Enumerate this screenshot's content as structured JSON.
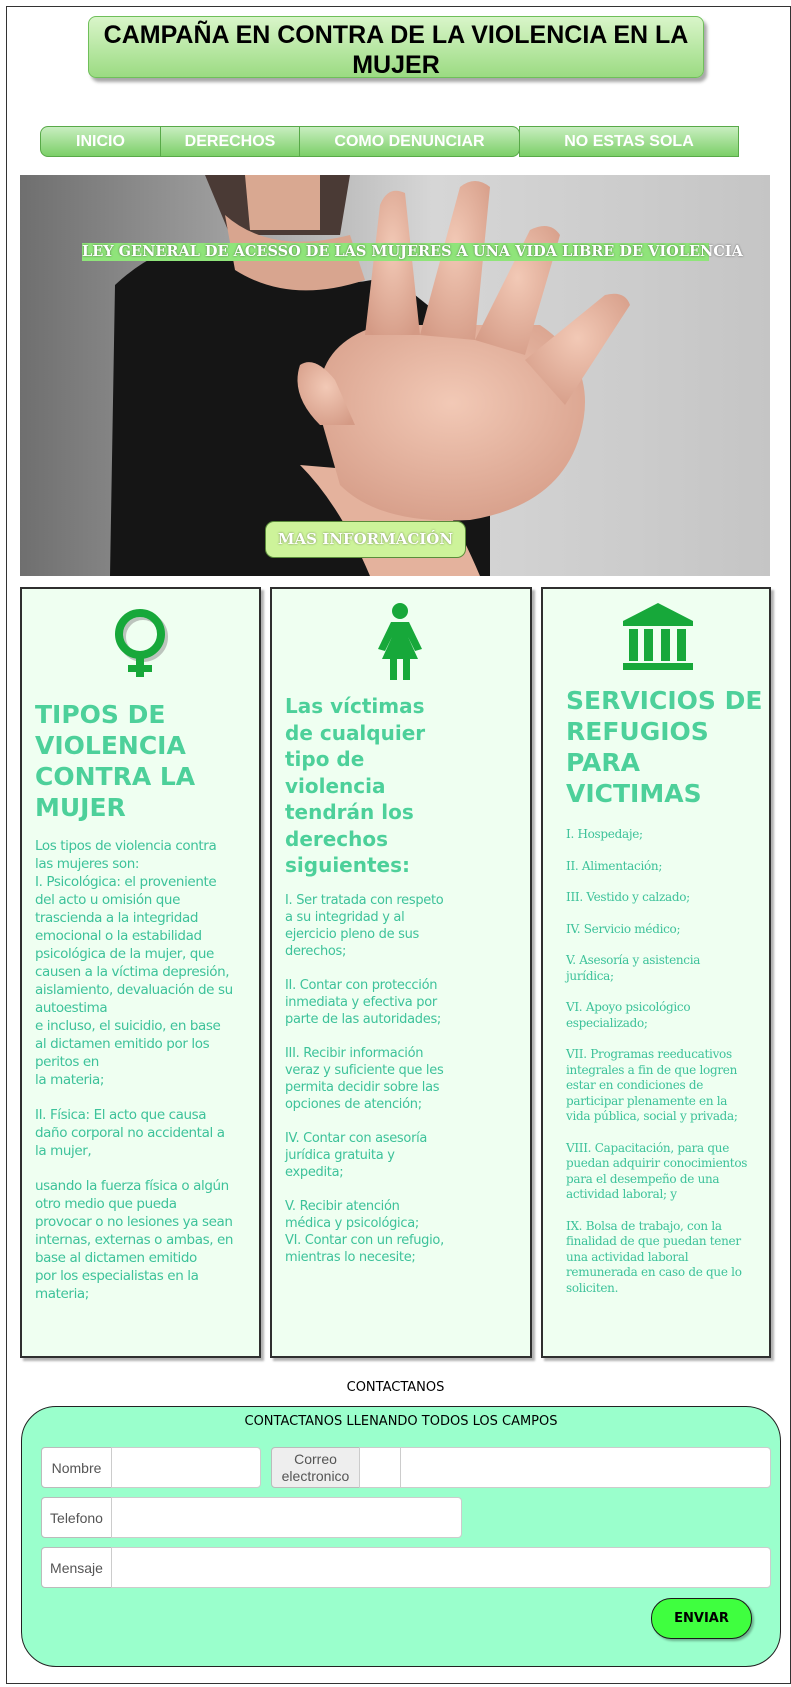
{
  "header": {
    "title": "CAMPAÑA EN CONTRA DE LA VIOLENCIA EN LA MUJER"
  },
  "nav": {
    "items": [
      {
        "label": "INICIO"
      },
      {
        "label": "DERECHOS"
      },
      {
        "label": "COMO DENUNCIAR"
      },
      {
        "label": "NO ESTAS SOLA"
      }
    ]
  },
  "hero": {
    "title": "LEY GENERAL DE ACESSO DE LAS MUJERES A UNA VIDA LIBRE DE VIOLENCIA",
    "button_label": "MAS INFORMACIÓN"
  },
  "cards": [
    {
      "icon": "female-symbol-icon",
      "title": "TIPOS DE VIOLENCIA CONTRA LA MUJER",
      "paragraphs": [
        "Los tipos de violencia contra las mujeres son:\nI. Psicológica: el proveniente del acto u omisión que trascienda a la integridad emocional o la estabilidad psicológica de la mujer, que\ncausen a la víctima depresión, aislamiento, devaluación de su autoestima\ne incluso, el suicidio, en base al dictamen emitido por los peritos en\nla materia;",
        "II. Física: El acto que causa daño corporal no accidental a la mujer,",
        "usando la fuerza física o algún otro medio que pueda provocar o no lesiones ya sean internas, externas o ambas, en base al dictamen emitido\npor los especialistas en la materia;"
      ]
    },
    {
      "icon": "woman-figure-icon",
      "title": "Las víctimas de cualquier tipo de violencia tendrán los derechos siguientes:",
      "paragraphs": [
        "I. Ser tratada con respeto a su integridad y al ejercicio pleno de sus derechos;",
        "II. Contar con protección inmediata y efectiva por parte de las autoridades;",
        "III. Recibir información veraz y suficiente que les permita decidir sobre las opciones de atención;",
        "IV. Contar con asesoría jurídica gratuita y expedita;",
        "V. Recibir atención médica y psicológica;\nVI. Contar con un refugio, mientras lo necesite;"
      ]
    },
    {
      "icon": "institution-building-icon",
      "title": "SERVICIOS DE REFUGIOS PARA VICTIMAS",
      "paragraphs": [
        "I. Hospedaje;",
        "II. Alimentación;",
        "III. Vestido y calzado;",
        "IV. Servicio médico;",
        "V. Asesoría y asistencia jurídica;",
        "VI. Apoyo psicológico especializado;",
        "VII. Programas reeducativos integrales a fin de que logren estar en condiciones de participar plenamente en la vida pública, social y privada;",
        "VIII. Capacitación, para que puedan adquirir conocimientos para el desempeño de una actividad laboral; y",
        "IX. Bolsa de trabajo, con la finalidad de que puedan tener una actividad laboral remunerada en caso de que lo soliciten."
      ]
    }
  ],
  "contact": {
    "heading": "CONTACTANOS",
    "subheading": "CONTACTANOS LLENANDO TODOS LOS CAMPOS",
    "fields": {
      "name_label": "Nombre",
      "email_label": "Correo electronico",
      "phone_label": "Telefono",
      "message_label": "Mensaje"
    },
    "submit_label": "ENVIAR"
  },
  "colors": {
    "accent_green": "#8fe47a",
    "card_background": "#effff1",
    "card_title": "#4dd09a",
    "contact_background": "#9affcc",
    "submit_button": "#3fff3f",
    "icon_green": "#17a83a"
  }
}
